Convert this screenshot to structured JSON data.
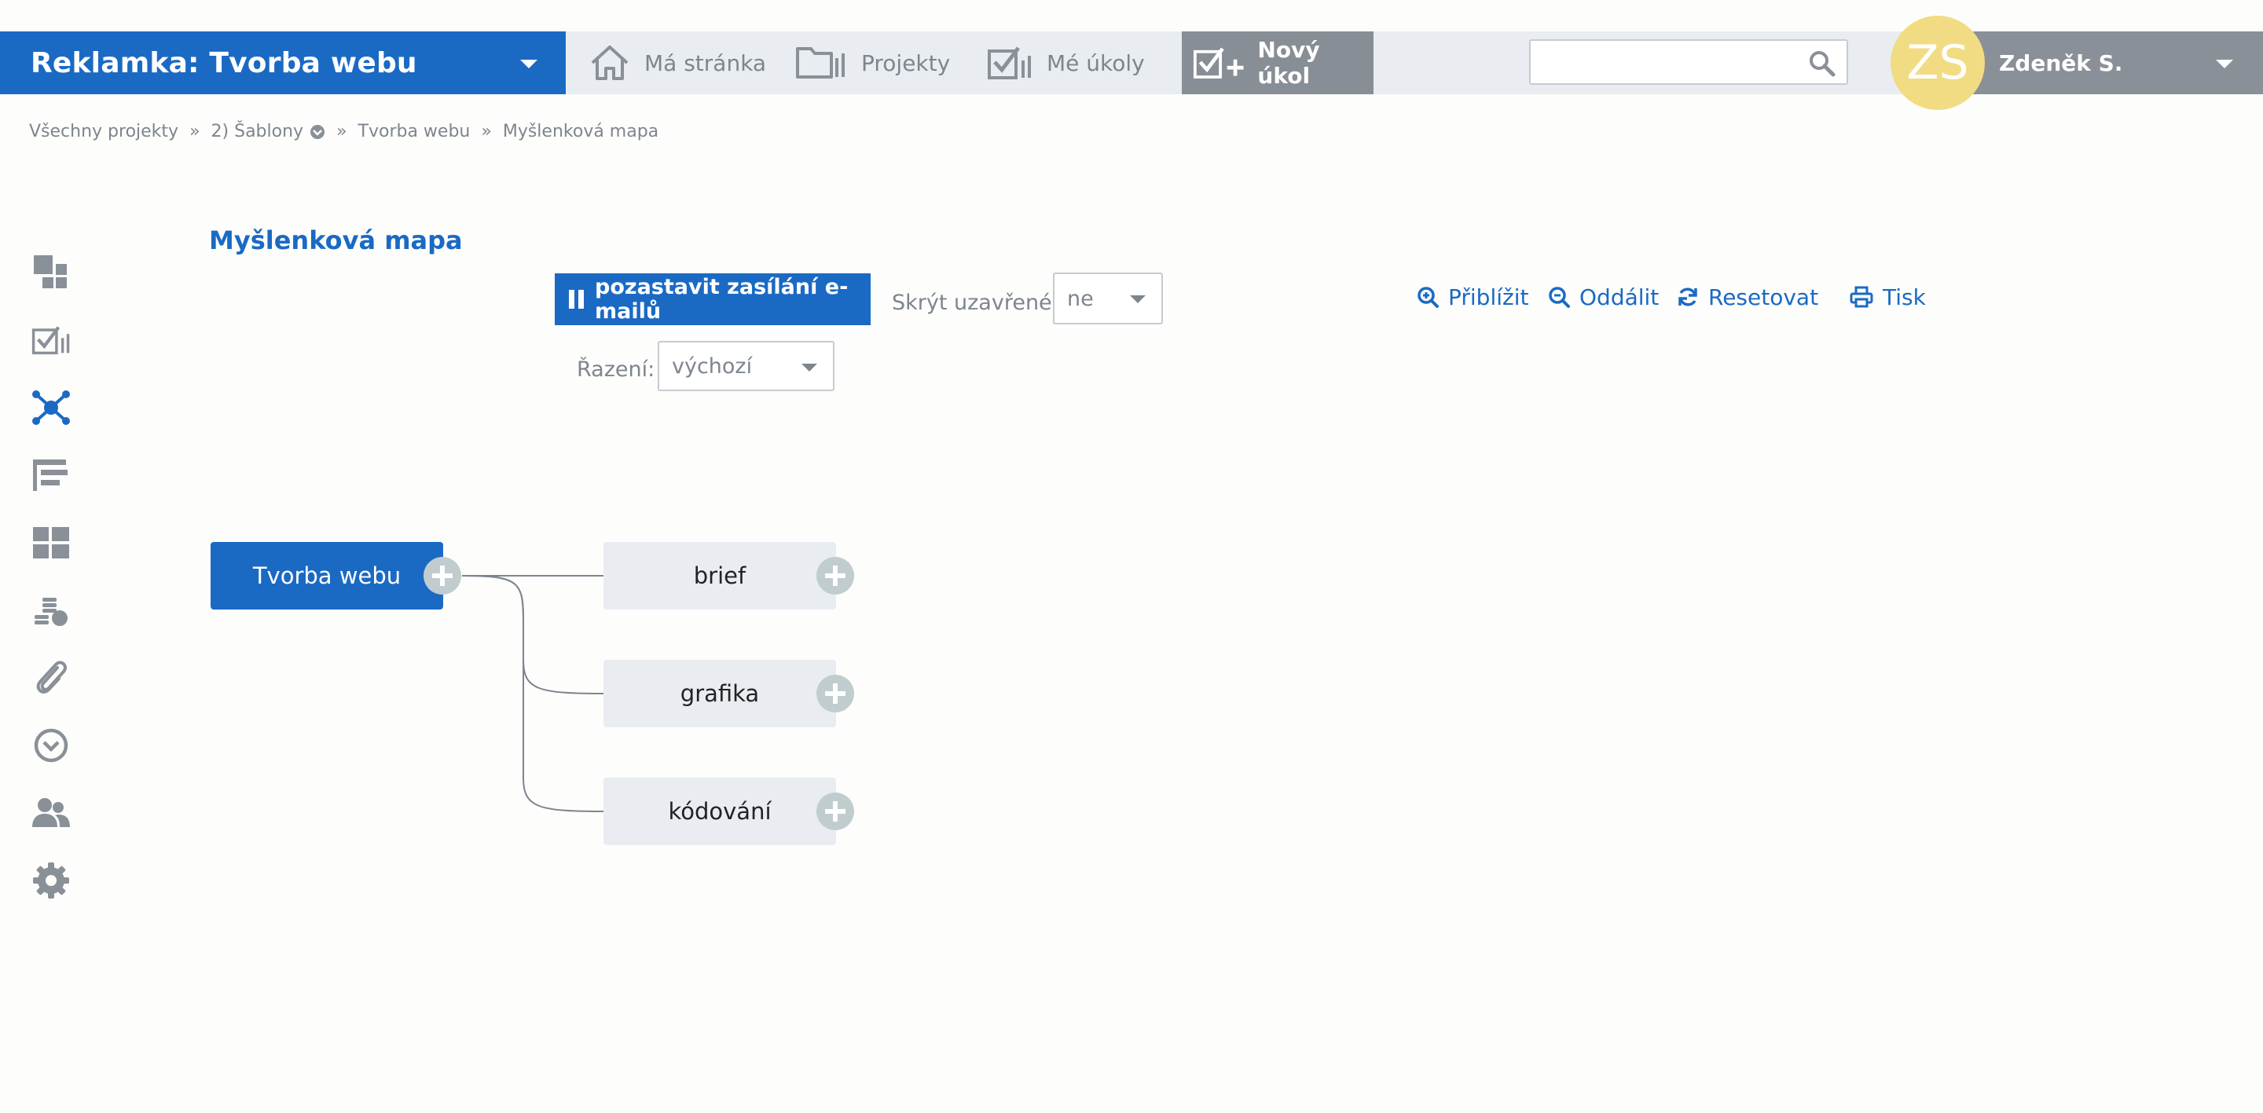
{
  "header": {
    "project_title": "Reklamka: Tvorba webu",
    "nav": {
      "home": "Má stránka",
      "projects": "Projekty",
      "tasks": "Mé úkoly"
    },
    "new_task": "Nový úkol",
    "search_placeholder": "",
    "user_initials": "ZS",
    "user_name": "Zdeněk S."
  },
  "breadcrumb": {
    "items": [
      "Všechny projekty",
      "2) Šablony",
      "Tvorba webu",
      "Myšlenková mapa"
    ],
    "separator": "»"
  },
  "sidebar": {
    "icons": [
      "dashboard-icon",
      "tasks-icon",
      "mindmap-icon",
      "gantt-icon",
      "board-icon",
      "budget-icon",
      "attachments-icon",
      "time-icon",
      "team-icon",
      "settings-icon"
    ],
    "active": "mindmap-icon"
  },
  "page": {
    "title": "Myšlenková mapa"
  },
  "toolbar": {
    "pause_emails": "pozastavit zasílání e-mailů",
    "hide_closed_label": "Skrýt uzavřené:",
    "hide_closed_value": "ne",
    "sort_label": "Řazení:",
    "sort_value": "výchozí",
    "zoom_in": "Přiblížit",
    "zoom_out": "Oddálit",
    "reset": "Resetovat",
    "print": "Tisk"
  },
  "mindmap": {
    "root": "Tvorba webu",
    "children": [
      "brief",
      "grafika",
      "kódování"
    ]
  },
  "colors": {
    "primary": "#1a6ac4",
    "topbar_bg": "#e9edf1",
    "user_bg": "#8a9097",
    "avatar": "#f2dc83",
    "node_bg": "#e9edf1",
    "add_button": "#c1cccf"
  }
}
